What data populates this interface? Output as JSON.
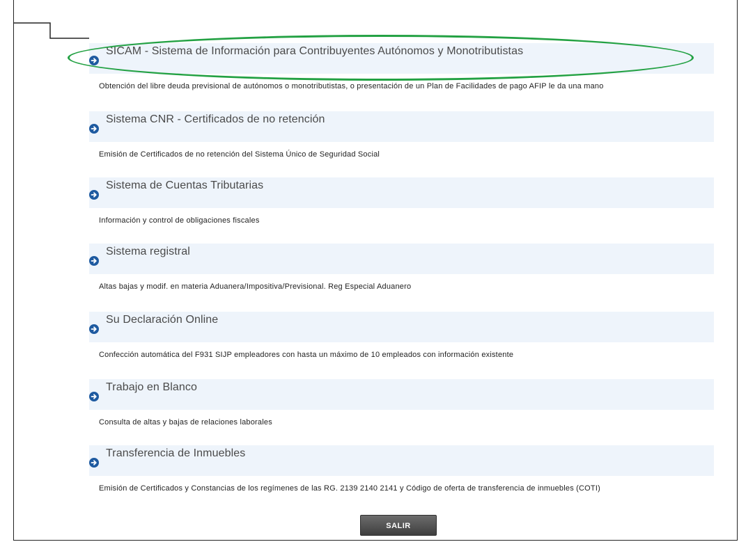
{
  "items": [
    {
      "title": "SICAM - Sistema de Información para Contribuyentes Autónomos y Monotributistas",
      "description": "Obtención del libre deuda previsional de autónomos o monotributistas, o presentación de un Plan de Facilidades de pago AFIP le da una mano",
      "highlighted": true
    },
    {
      "title": "Sistema CNR - Certificados de no retención",
      "description": "Emisión de Certificados de no retención del Sistema Único de Seguridad Social"
    },
    {
      "title": "Sistema de Cuentas Tributarias",
      "description": "Información y control de obligaciones fiscales"
    },
    {
      "title": "Sistema registral",
      "description": "Altas bajas y modif. en materia Aduanera/Impositiva/Previsional. Reg Especial Aduanero"
    },
    {
      "title": "Su Declaración Online",
      "description": "Confección automática del F931 SIJP empleadores con hasta un máximo de 10 empleados con información existente"
    },
    {
      "title": "Trabajo en Blanco",
      "description": "Consulta de altas y bajas de relaciones laborales"
    },
    {
      "title": "Transferencia de Inmuebles",
      "description": "Emisión de Certificados y Constancias de los regímenes de las RG. 2139 2140 2141 y Código de oferta de transferencia de inmuebles (COTI)"
    }
  ],
  "buttons": {
    "exit_label": "SALIR"
  },
  "colors": {
    "highlight": "#23a143",
    "arrow": "#1e5aa0",
    "header_bg": "#eef4fb"
  },
  "icons": {
    "item_arrow": "arrow-right-circle-icon"
  }
}
